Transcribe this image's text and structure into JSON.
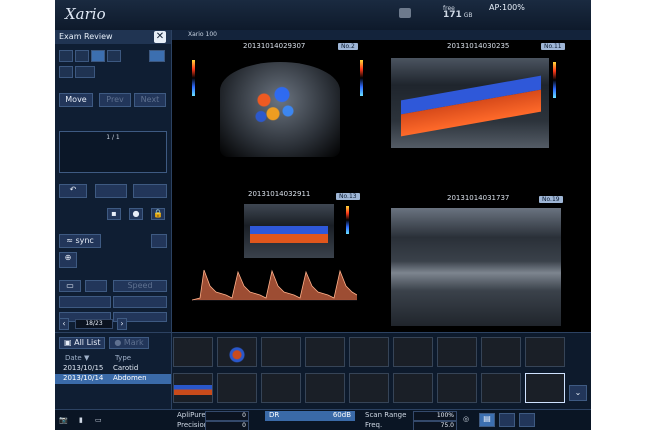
{
  "header": {
    "brand": "Xario",
    "free_label": "free",
    "free_value": "171",
    "free_unit": "GB",
    "ap": "AP:100%"
  },
  "exam_review": {
    "title": "Exam Review",
    "move_label": "Move",
    "prev_label": "Prev",
    "next_label": "Next",
    "page": "1 / 1",
    "sync_label": "sync",
    "speed_label": "Speed",
    "pager": "18/23"
  },
  "viewer": {
    "title": "Xario 100",
    "panes": [
      {
        "timestamp": "20131014029307",
        "badge": "No.2"
      },
      {
        "timestamp": "20131014030235",
        "badge": "No.11"
      },
      {
        "timestamp": "20131014032911",
        "badge": "No.13"
      },
      {
        "timestamp": "20131014031737",
        "badge": "No.19"
      }
    ]
  },
  "exam_list": {
    "all_list_label": "All List",
    "mark_label": "Mark",
    "col_date": "Date",
    "col_type": "Type",
    "rows": [
      {
        "date": "2013/10/15",
        "type": "Carotid"
      },
      {
        "date": "2013/10/14",
        "type": "Abdomen"
      }
    ]
  },
  "status": {
    "aplipure_label": "ApliPure",
    "aplipure_value": "0",
    "precision_label": "Precision",
    "precision_value": "0",
    "dr_label": "DR",
    "dr_value": "60dB",
    "scan_range_label": "Scan Range",
    "scan_range_value": "100%",
    "freq_label": "Freq.",
    "freq_value": "75.0"
  },
  "colors": {
    "accent": "#3c6fb0",
    "selected": "#3a6aa8"
  }
}
